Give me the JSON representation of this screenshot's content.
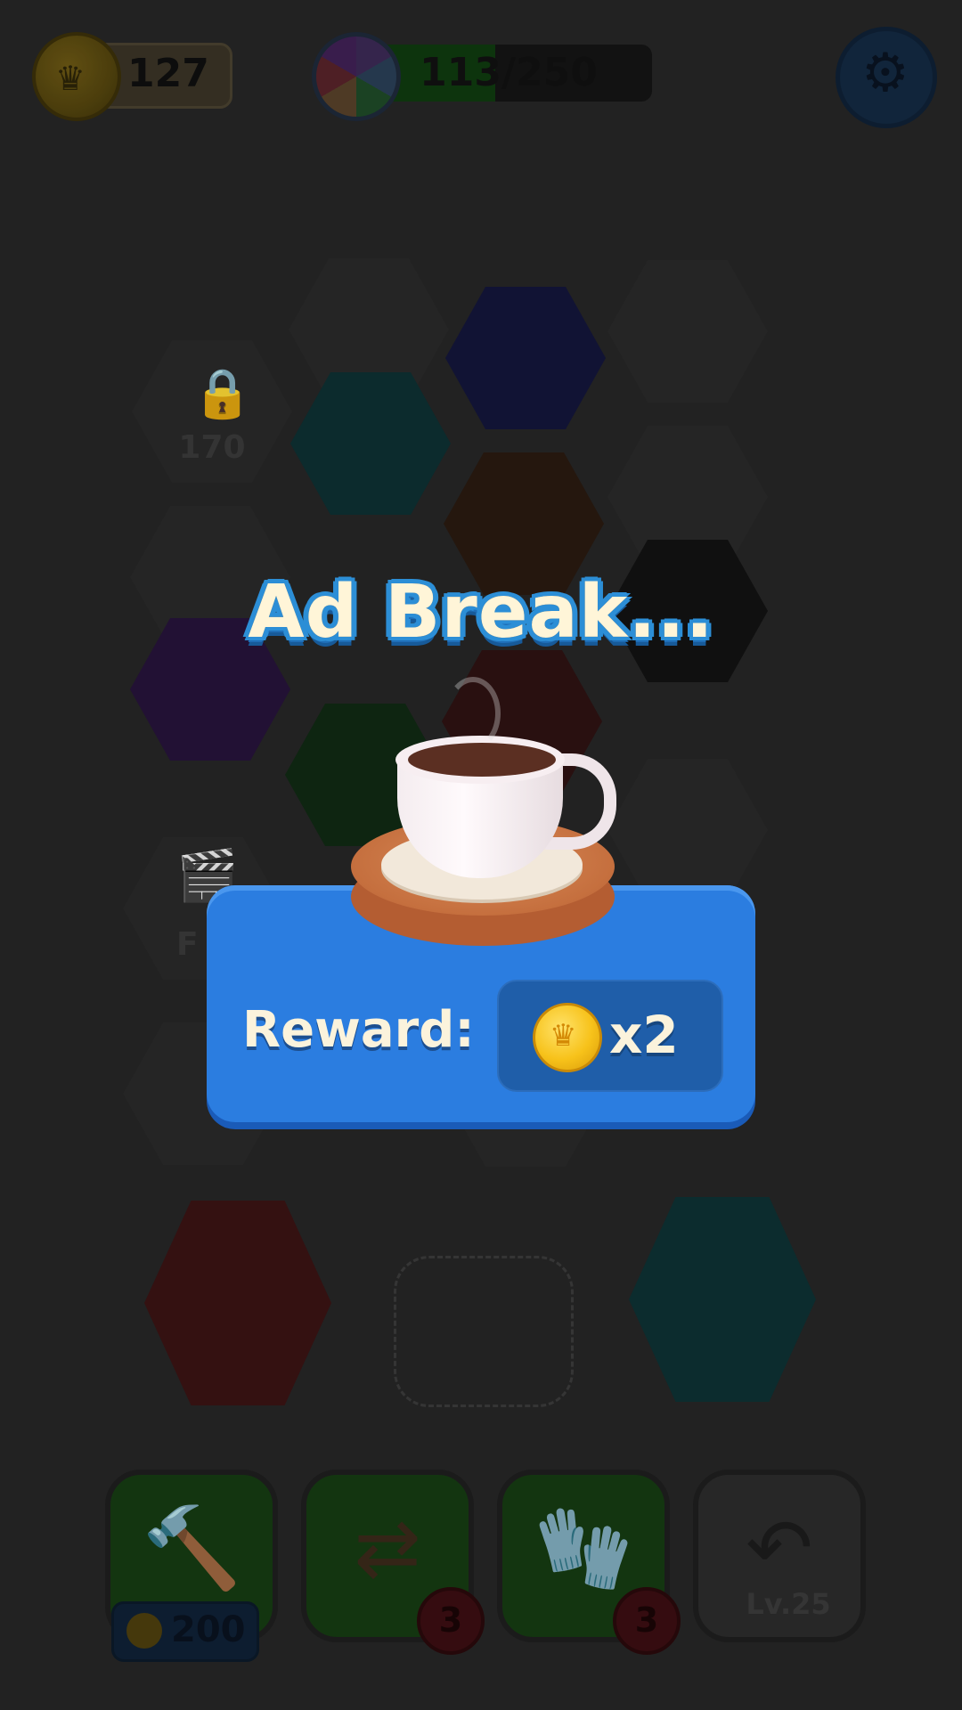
{
  "hud": {
    "coins": "127",
    "progress_text": "113/250",
    "progress_fraction": 0.452
  },
  "board": {
    "locked_cell_cost": "170",
    "video_cell_label": "F"
  },
  "toolbar": {
    "hammer_price": "200",
    "swap_count": "3",
    "glove_count": "3",
    "undo_lock_label": "Lv.25"
  },
  "ad_break": {
    "title": "Ad Break...",
    "reward_label": "Reward:",
    "reward_multiplier": "x2"
  },
  "colors": {
    "dialog_blue": "#2b7de0",
    "title_outline": "#2c8ed6",
    "coin_gold": "#f7c21a",
    "text_cream": "#fbf3dc"
  },
  "icons": [
    "coin-crown-icon",
    "color-wheel-icon",
    "gear-icon",
    "lock-icon",
    "clapperboard-icon",
    "hammer-icon",
    "swap-arrows-icon",
    "glove-icon",
    "undo-icon",
    "coffee-cup-icon"
  ]
}
